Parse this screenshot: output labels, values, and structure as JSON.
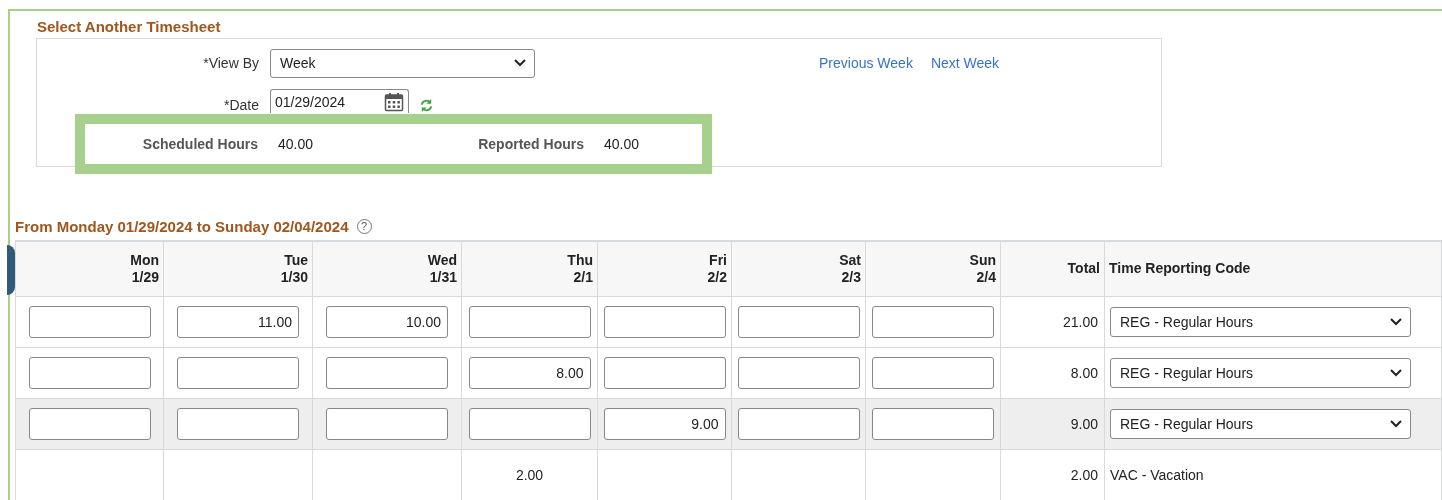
{
  "section_title": "Select Another Timesheet",
  "view_by": {
    "label": "*View By",
    "value": "Week"
  },
  "date": {
    "label": "*Date",
    "value": "01/29/2024"
  },
  "links": [
    "Previous Week",
    "Next Week"
  ],
  "summary": [
    {
      "label": "Scheduled Hours",
      "value": "40.00"
    },
    {
      "label": "Reported Hours",
      "value": "40.00"
    }
  ],
  "period_title": "From Monday 01/29/2024 to Sunday 02/04/2024",
  "help_icon": "?",
  "table": {
    "day_columns": [
      {
        "day": "Mon",
        "date": "1/29"
      },
      {
        "day": "Tue",
        "date": "1/30"
      },
      {
        "day": "Wed",
        "date": "1/31"
      },
      {
        "day": "Thu",
        "date": "2/1"
      },
      {
        "day": "Fri",
        "date": "2/2"
      },
      {
        "day": "Sat",
        "date": "2/3"
      },
      {
        "day": "Sun",
        "date": "2/4"
      }
    ],
    "total_header": "Total",
    "code_header": "Time Reporting Code",
    "rows": [
      {
        "kind": "entry",
        "highlighted": false,
        "hours": [
          {
            "kind": "input"
          },
          {
            "kind": "input",
            "value": "11.00"
          },
          {
            "kind": "input",
            "value": "10.00"
          },
          {
            "kind": "input"
          },
          {
            "kind": "input"
          },
          {
            "kind": "input"
          },
          {
            "kind": "input"
          }
        ],
        "total": "21.00",
        "code": "REG - Regular Hours"
      },
      {
        "kind": "entry",
        "highlighted": false,
        "hours": [
          {
            "kind": "input"
          },
          {
            "kind": "input"
          },
          {
            "kind": "input"
          },
          {
            "kind": "input",
            "value": "8.00"
          },
          {
            "kind": "input"
          },
          {
            "kind": "input"
          },
          {
            "kind": "input"
          }
        ],
        "total": "8.00",
        "code": "REG - Regular Hours"
      },
      {
        "kind": "entry",
        "highlighted": true,
        "hours": [
          {
            "kind": "input"
          },
          {
            "kind": "input"
          },
          {
            "kind": "input"
          },
          {
            "kind": "input"
          },
          {
            "kind": "input",
            "value": "9.00"
          },
          {
            "kind": "input"
          },
          {
            "kind": "input"
          }
        ],
        "total": "9.00",
        "code": "REG - Regular Hours"
      },
      {
        "kind": "summary",
        "highlighted": false,
        "hours": [
          {
            "kind": "blank"
          },
          {
            "kind": "blank"
          },
          {
            "kind": "blank"
          },
          {
            "kind": "text",
            "value": "2.00"
          },
          {
            "kind": "blank"
          },
          {
            "kind": "blank"
          },
          {
            "kind": "blank"
          }
        ],
        "total": "2.00",
        "code": "VAC - Vacation"
      }
    ]
  }
}
